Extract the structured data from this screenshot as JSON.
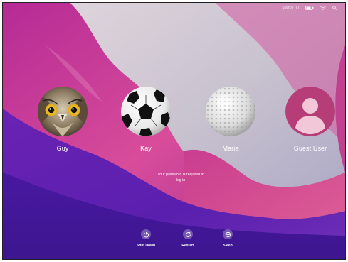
{
  "menubar": {
    "keyboard_label": "Source (T)",
    "battery_icon": "battery-icon",
    "wifi_icon": "wifi-icon",
    "search_icon": "search-icon"
  },
  "users": [
    {
      "name": "Guy",
      "avatar": "owl-avatar"
    },
    {
      "name": "Kay",
      "avatar": "soccer-ball-avatar"
    },
    {
      "name": "Maria",
      "avatar": "golf-ball-avatar"
    },
    {
      "name": "Guest User",
      "avatar": "guest-silhouette-avatar"
    }
  ],
  "message": {
    "line1": "Your password is required to",
    "line2": "log in"
  },
  "actions": [
    {
      "label": "Shut Down",
      "icon": "power-icon"
    },
    {
      "label": "Restart",
      "icon": "restart-icon"
    },
    {
      "label": "Sleep",
      "icon": "sleep-icon"
    }
  ],
  "colors": {
    "wallpaper_pink": "#d8449a",
    "wallpaper_purple": "#5a20b8",
    "wallpaper_light": "#cfc7d2",
    "guest_avatar": "#b63d78"
  }
}
